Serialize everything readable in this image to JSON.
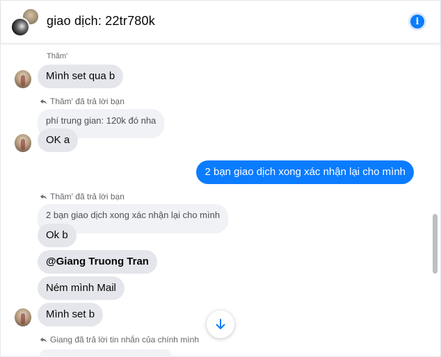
{
  "header": {
    "title": "giao dịch: 22tr780k",
    "info_icon_glyph": "i"
  },
  "messages": {
    "m1_sender": "Thăm'",
    "m1_text": "Mình set qua b",
    "m2_reply_note": "Thăm' đã trả lời bạn",
    "m2_quote": "phí trung gian: 120k đó nha",
    "m2_text": "OK a",
    "m3_mine": "2 bạn giao dịch xong xác nhận lại cho mình",
    "m4_reply_note": "Thăm' đã trả lời bạn",
    "m4_quote": "2 bạn giao dịch xong xác nhận lại cho mình",
    "m4_text_1": "Ok b",
    "m4_text_2": "@Giang Truong Tran",
    "m4_text_3": "Ném mình Mail",
    "m4_text_4": "Mình set b",
    "m5_reply_note": "Giang đã trả lời tin nhắn của chính mình"
  },
  "colors": {
    "accent": "#0a7cff",
    "bubble_other": "#e4e6eb",
    "quote_bg": "#f0f2f5"
  },
  "icons": {
    "info": "info-icon",
    "reply": "reply-arrow-icon",
    "scroll_down": "arrow-down-icon"
  }
}
